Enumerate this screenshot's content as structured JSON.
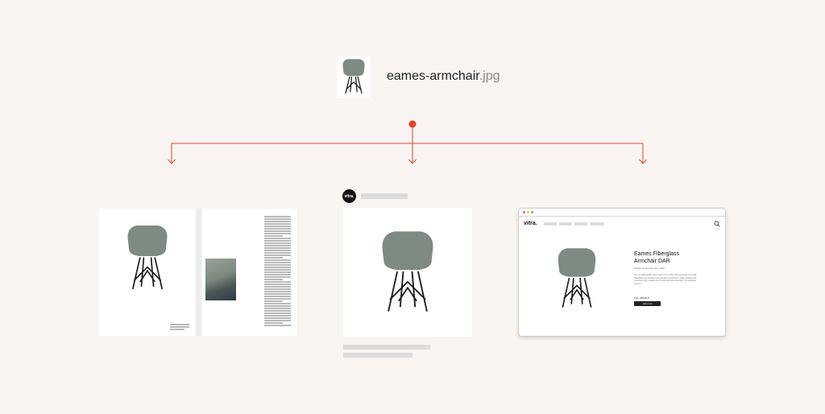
{
  "file": {
    "name": "eames-armchair",
    "extension": ".jpg"
  },
  "colors": {
    "background": "#f8f5f3",
    "accent": "#e2442a",
    "shell": "#7f8a85",
    "leg": "#1c1c1c",
    "placeholder": "#dcdcdc"
  },
  "outputs": [
    {
      "kind": "magazine-spread"
    },
    {
      "kind": "social-post",
      "avatar_text": "vitra."
    },
    {
      "kind": "web-product-page",
      "logo": "vitra.",
      "product_title": "Eames Fiberglass Armchair DAR",
      "designer": "Charles & Ray Eames, 1950",
      "description": "The so-called Eiffel Tower base of the DAR (Dining Height Armchair Rod Base) an intricate and graceful construction made of steel wire, combines light, elegant forms with structural strength. The plebeian comfort...",
      "price": "from 765,00 €",
      "cart_button": "Add to cart"
    }
  ]
}
